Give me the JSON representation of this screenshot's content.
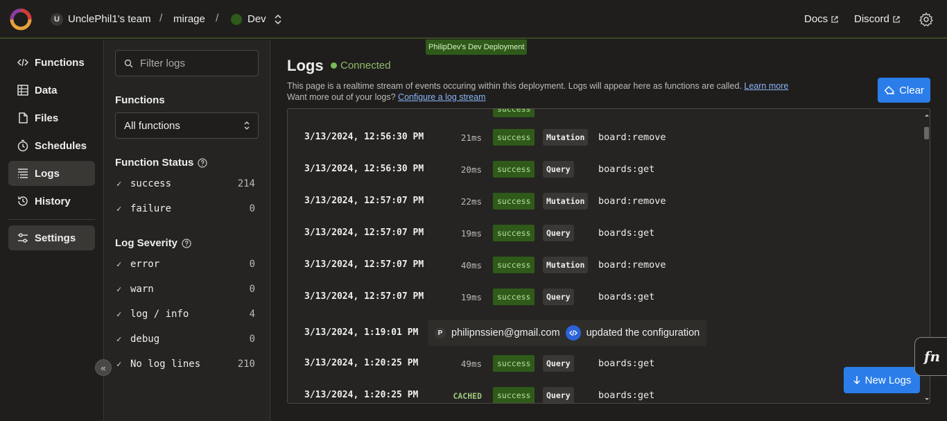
{
  "header": {
    "team_initial": "U",
    "team_name": "UnclePhil1's team",
    "separator": "/",
    "project_name": "mirage",
    "deployment_name": "Dev",
    "docs_label": "Docs",
    "discord_label": "Discord",
    "deploy_badge": "PhilipDev's Dev Deployment"
  },
  "nav": {
    "items": [
      {
        "label": "Functions",
        "icon": "code-icon"
      },
      {
        "label": "Data",
        "icon": "table-icon"
      },
      {
        "label": "Files",
        "icon": "file-icon"
      },
      {
        "label": "Schedules",
        "icon": "clock-icon"
      },
      {
        "label": "Logs",
        "icon": "list-icon",
        "active": true
      },
      {
        "label": "History",
        "icon": "history-icon"
      },
      {
        "label": "Settings",
        "icon": "sliders-icon"
      }
    ],
    "collapse_glyph": "«"
  },
  "filters": {
    "search_placeholder": "Filter logs",
    "functions_title": "Functions",
    "functions_selected": "All functions",
    "status_title": "Function Status",
    "status": [
      {
        "label": "success",
        "count": "214"
      },
      {
        "label": "failure",
        "count": "0"
      }
    ],
    "severity_title": "Log Severity",
    "severity": [
      {
        "label": "error",
        "count": "0"
      },
      {
        "label": "warn",
        "count": "0"
      },
      {
        "label": "log / info",
        "count": "4"
      },
      {
        "label": "debug",
        "count": "0"
      },
      {
        "label": "No log lines",
        "count": "210"
      }
    ]
  },
  "main": {
    "title": "Logs",
    "connection": "Connected",
    "desc_line1": "This page is a realtime stream of events occuring within this deployment. Logs will appear here as functions are called.",
    "learn_more": "Learn more",
    "desc_line2": "Want more out of your logs?",
    "configure_link": "Configure a log stream",
    "clear_label": "Clear",
    "new_logs_label": "New Logs",
    "fn_label": "fn"
  },
  "logs": [
    {
      "ts": "3/13/2024, 12:56:30 PM",
      "dur": "21ms",
      "status": "success",
      "kind": "Mutation",
      "fn": "board:remove"
    },
    {
      "ts": "3/13/2024, 12:56:30 PM",
      "dur": "20ms",
      "status": "success",
      "kind": "Query",
      "fn": "boards:get"
    },
    {
      "ts": "3/13/2024, 12:57:07 PM",
      "dur": "22ms",
      "status": "success",
      "kind": "Mutation",
      "fn": "board:remove"
    },
    {
      "ts": "3/13/2024, 12:57:07 PM",
      "dur": "19ms",
      "status": "success",
      "kind": "Query",
      "fn": "boards:get"
    },
    {
      "ts": "3/13/2024, 12:57:07 PM",
      "dur": "40ms",
      "status": "success",
      "kind": "Mutation",
      "fn": "board:remove"
    },
    {
      "ts": "3/13/2024, 12:57:07 PM",
      "dur": "19ms",
      "status": "success",
      "kind": "Query",
      "fn": "boards:get"
    }
  ],
  "config_event": {
    "ts": "3/13/2024, 1:19:01 PM",
    "user_initial": "P",
    "email": "philipnssien@gmail.com",
    "action": "updated the configuration"
  },
  "logs_after": [
    {
      "ts": "3/13/2024, 1:20:25 PM",
      "dur": "49ms",
      "status": "success",
      "kind": "Query",
      "fn": "boards:get"
    },
    {
      "ts": "3/13/2024, 1:20:25 PM",
      "dur": "CACHED",
      "status": "success",
      "kind": "Query",
      "fn": "boards:get"
    }
  ],
  "colors": {
    "accent_blue": "#2b7de9",
    "success_green": "#2f5a1a",
    "connected_green": "#8fbc6a"
  }
}
